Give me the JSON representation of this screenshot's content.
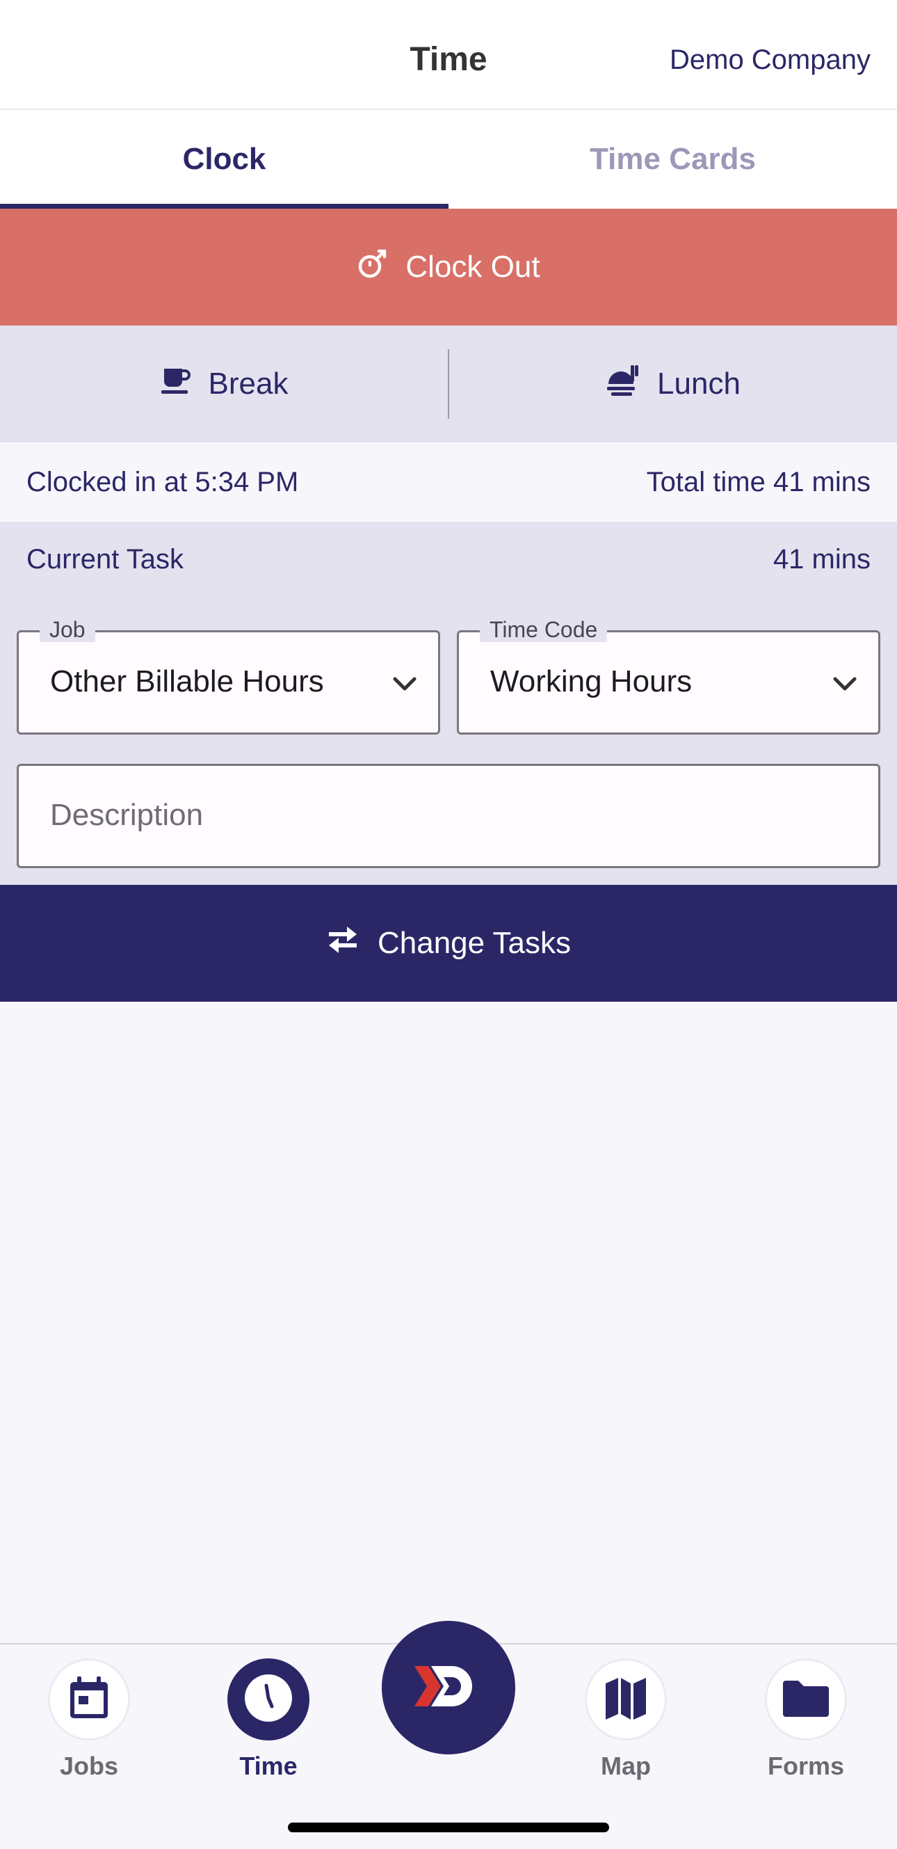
{
  "header": {
    "title": "Time",
    "company": "Demo Company"
  },
  "tabs": [
    {
      "label": "Clock",
      "active": true
    },
    {
      "label": "Time Cards",
      "active": false
    }
  ],
  "clock_out": {
    "label": "Clock Out",
    "icon": "stopwatch-icon",
    "color": "#d97068"
  },
  "break_bar": {
    "break": {
      "label": "Break",
      "icon": "coffee-cup-icon"
    },
    "lunch": {
      "label": "Lunch",
      "icon": "food-tray-icon"
    }
  },
  "status": {
    "clocked_in": "Clocked in at 5:34 PM",
    "total_time": "Total time 41 mins"
  },
  "current_task": {
    "title": "Current Task",
    "duration": "41 mins",
    "job": {
      "label": "Job",
      "value": "Other Billable Hours"
    },
    "time_code": {
      "label": "Time Code",
      "value": "Working Hours"
    },
    "description": {
      "placeholder": "Description"
    }
  },
  "change_tasks": {
    "label": "Change Tasks",
    "icon": "swap-arrows-icon",
    "color": "#2b2767"
  },
  "bottom_nav": {
    "items": [
      {
        "label": "Jobs",
        "icon": "calendar-icon",
        "active": false
      },
      {
        "label": "Time",
        "icon": "clock-icon",
        "active": true
      },
      {
        "label": "Map",
        "icon": "map-icon",
        "active": false
      },
      {
        "label": "Forms",
        "icon": "folder-icon",
        "active": false
      }
    ],
    "center": {
      "icon": "brand-logo-icon"
    }
  }
}
